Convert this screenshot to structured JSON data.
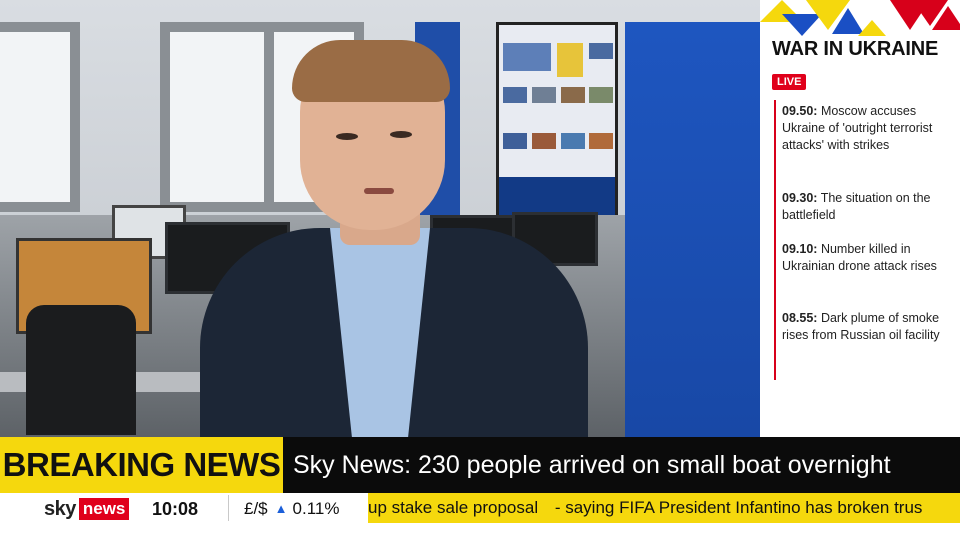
{
  "side_panel": {
    "title": "WAR IN UKRAINE",
    "live_label": "LIVE",
    "events": [
      {
        "time": "09.50:",
        "text": "Moscow accuses Ukraine of 'outright terrorist attacks' with strikes"
      },
      {
        "time": "09.30:",
        "text": "The situation on the battlefield"
      },
      {
        "time": "09.10:",
        "text": "Number killed in Ukrainian drone attack rises"
      },
      {
        "time": "08.55:",
        "text": "Dark plume of smoke rises from Russian oil facility"
      }
    ],
    "colors": {
      "accent_red": "#e0001b",
      "flag_blue": "#1a4fc4",
      "flag_yellow": "#f5d80d"
    }
  },
  "breaking": {
    "label": "BREAKING NEWS",
    "headline": "Sky News: 230 people arrived on small boat overnight",
    "label_color": "#f5d80d"
  },
  "bottom_bar": {
    "brand_sky": "sky",
    "brand_news": "news",
    "clock": "10:08",
    "market_pair": "£/$",
    "market_icon": "up-triangle-icon",
    "market_change": "0.11%",
    "ticker_items": [
      "up stake sale proposal",
      "- saying FIFA President Infantino has broken trus"
    ]
  }
}
